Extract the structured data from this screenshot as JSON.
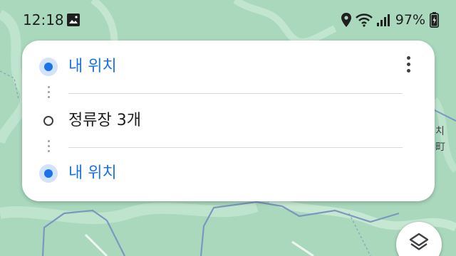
{
  "status_bar": {
    "time": "12:18",
    "battery_percent": "97%",
    "icons": [
      "gallery-icon",
      "location-icon",
      "wifi-icon",
      "signal-icon",
      "battery-icon"
    ]
  },
  "route": {
    "start_label": "내 위치",
    "stop_label": "정류장 3개",
    "end_label": "내 위치",
    "more_icon": "more-vert-icon"
  },
  "map": {
    "edge_labels": [
      "치",
      "町"
    ],
    "layers_icon": "layers-icon"
  },
  "colors": {
    "map_green": "#a9d8bd",
    "accent_blue": "#1a73e8",
    "road_blue": "#7b97bf"
  }
}
